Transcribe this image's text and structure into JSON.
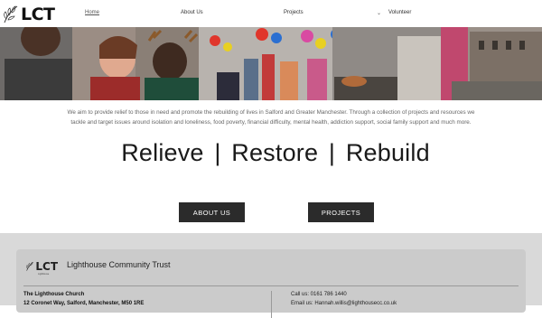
{
  "brand": {
    "logo_text": "LCT"
  },
  "nav": {
    "home": "Home",
    "about": "About Us",
    "projects": "Projects",
    "projects_chevron": "⌄",
    "volunteer": "Volunteer"
  },
  "intro": "We aim to provide relief to those in need and promote the rebuilding of lives in Salford and Greater Manchester. Through a collection of projects and resources we tackle and target issues around isolation and loneliness, food poverty, financial difficulty, mental health, addiction support, social family support and much more.",
  "tagline": "Relieve  |  Restore  |  Rebuild",
  "buttons": {
    "about": "ABOUT US",
    "projects": "PROJECTS"
  },
  "footer": {
    "logo_text": "LCT",
    "logo_sub": "Lighthouse",
    "title": "Lighthouse Community Trust",
    "address_name": "The Lighthouse Church",
    "address_street": "12 Coronet Way, Salford, Manchester, M50 1RE",
    "phone": "Call us: 0161 786 1440",
    "email": "Email us: Hannah.willis@lighthousecc.co.uk"
  }
}
